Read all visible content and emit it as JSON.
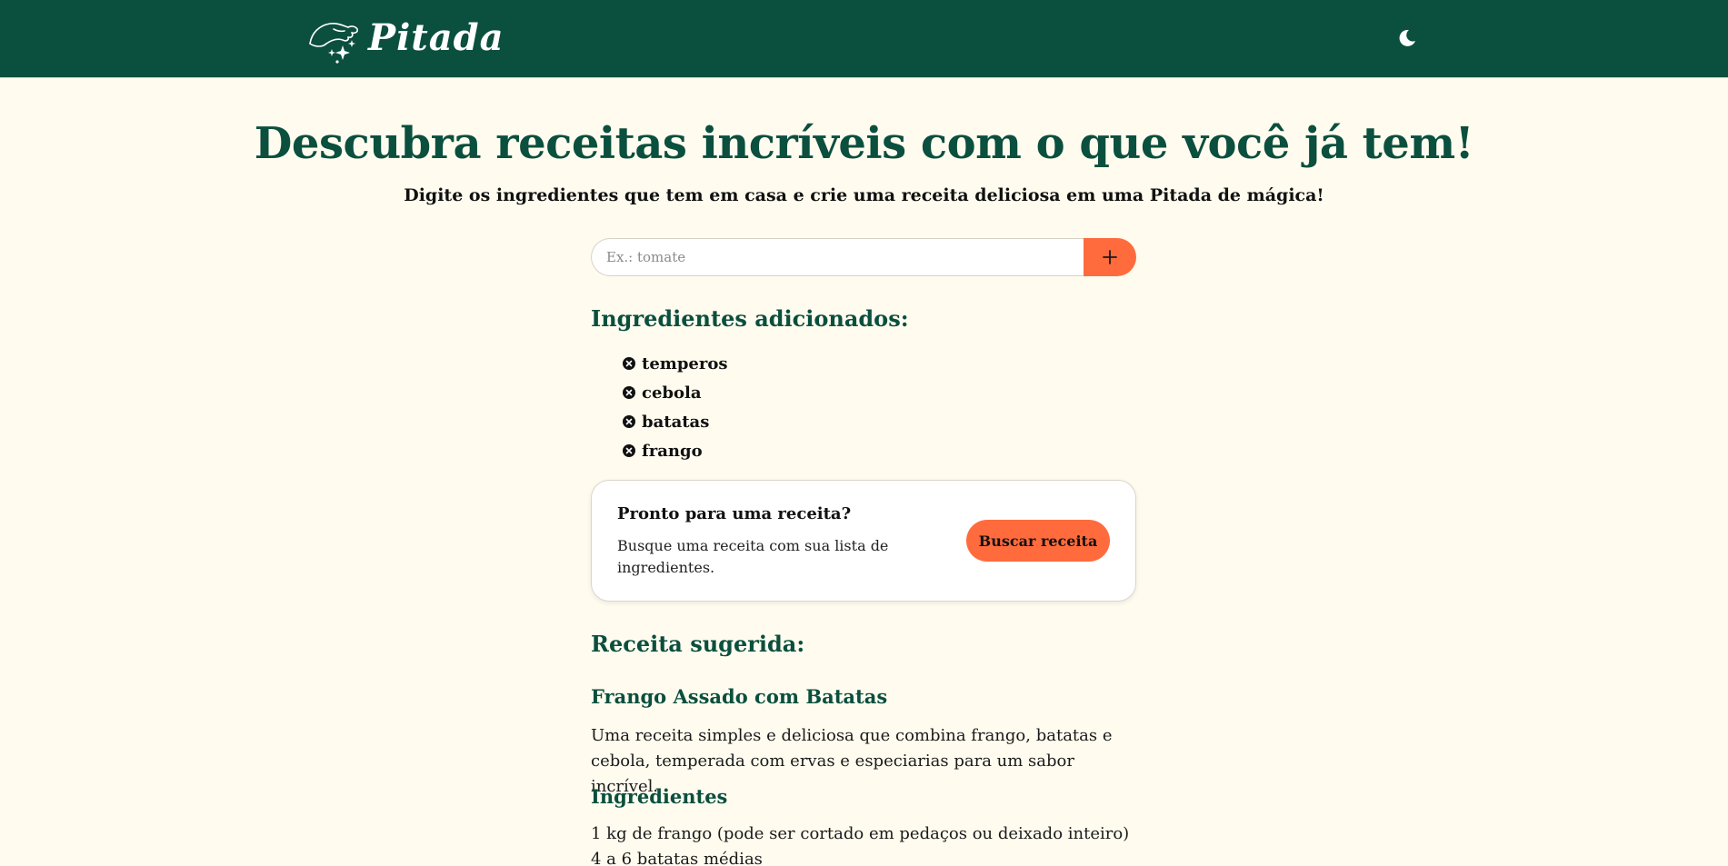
{
  "header": {
    "logo_text": "Pitada",
    "theme_toggle_icon": "moon-icon",
    "background_color": "#0b4f3e"
  },
  "hero": {
    "title": "Descubra receitas incríveis com o que você já tem!",
    "subtitle": "Digite os ingredientes que tem em casa e crie uma receita deliciosa em uma Pitada de mágica!"
  },
  "search": {
    "placeholder": "Ex.: tomate",
    "value": "",
    "add_button_icon": "plus-icon"
  },
  "ingredients": {
    "title": "Ingredientes adicionados:",
    "items": [
      "temperos",
      "cebola",
      "batatas",
      "frango"
    ],
    "remove_icon": "x-circle-icon"
  },
  "cta": {
    "title": "Pronto para uma receita?",
    "description": "Busque uma receita com sua lista de ingredientes.",
    "button_label": "Buscar receita"
  },
  "recipe": {
    "section_title": "Receita sugerida:",
    "name": "Frango Assado com Batatas",
    "description": "Uma receita simples e deliciosa que combina frango, batatas e cebola, temperada com ervas e especiarias para um sabor incrível.",
    "ingredients_title": "Ingredientes",
    "ingredients": [
      "1 kg de frango (pode ser cortado em pedaços ou deixado inteiro)",
      "4 a 6 batatas médias"
    ]
  },
  "colors": {
    "primary": "#0b4f3e",
    "accent": "#ff6b3d",
    "background": "#fffcef"
  }
}
